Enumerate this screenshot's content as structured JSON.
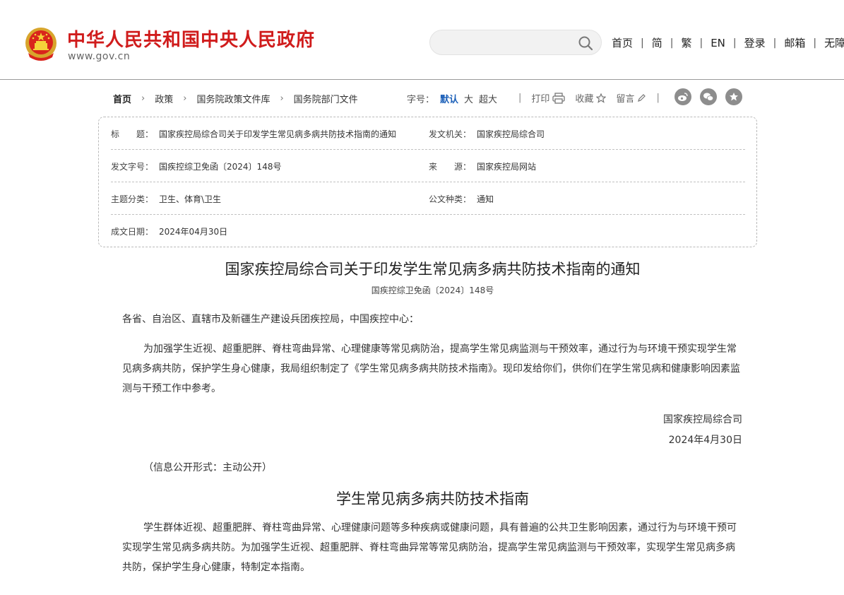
{
  "header": {
    "site_title": "中华人民共和国中央人民政府",
    "site_url": "www.gov.cn",
    "search_placeholder": "",
    "nav": [
      "首页",
      "简",
      "繁",
      "EN",
      "登录",
      "邮箱",
      "无障碍"
    ]
  },
  "breadcrumb": [
    "首页",
    "政策",
    "国务院政策文件库",
    "国务院部门文件"
  ],
  "font_size": {
    "label": "字号：",
    "options": [
      "默认",
      "大",
      "超大"
    ],
    "selected": "默认"
  },
  "actions": {
    "print": "打印",
    "favorite": "收藏",
    "comment": "留言"
  },
  "info": {
    "title_label": "标　　题：",
    "title_value": "国家疾控局综合司关于印发学生常见病多病共防技术指南的通知",
    "issuer_label": "发文机关：",
    "issuer_value": "国家疾控局综合司",
    "docno_label": "发文字号：",
    "docno_value": "国疾控综卫免函〔2024〕148号",
    "source_label": "来　　源：",
    "source_value": "国家疾控局网站",
    "topic_label": "主题分类：",
    "topic_value": "卫生、体育\\卫生",
    "type_label": "公文种类：",
    "type_value": "通知",
    "date_label": "成文日期：",
    "date_value": "2024年04月30日"
  },
  "article": {
    "title": "国家疾控局综合司关于印发学生常见病多病共防技术指南的通知",
    "doc_no": "国疾控综卫免函〔2024〕148号",
    "salutation": "各省、自治区、直辖市及新疆生产建设兵团疾控局，中国疾控中心：",
    "body": "为加强学生近视、超重肥胖、脊柱弯曲异常、心理健康等常见病防治，提高学生常见病监测与干预效率，通过行为与环境干预实现学生常见病多病共防，保护学生身心健康，我局组织制定了《学生常见病多病共防技术指南》。现印发给你们，供你们在学生常见病和健康影响因素监测与干预工作中参考。",
    "signer": "国家疾控局综合司",
    "sign_date": "2024年4月30日",
    "disclosure": "（信息公开形式：主动公开）",
    "section_title": "学生常见病多病共防技术指南",
    "section_body": "学生群体近视、超重肥胖、脊柱弯曲异常、心理健康问题等多种疾病或健康问题，具有普遍的公共卫生影响因素，通过行为与环境干预可实现学生常见病多病共防。为加强学生近视、超重肥胖、脊柱弯曲异常等常见病防治，提高学生常见病监测与干预效率，实现学生常见病多病共防，保护学生身心健康，特制定本指南。"
  }
}
